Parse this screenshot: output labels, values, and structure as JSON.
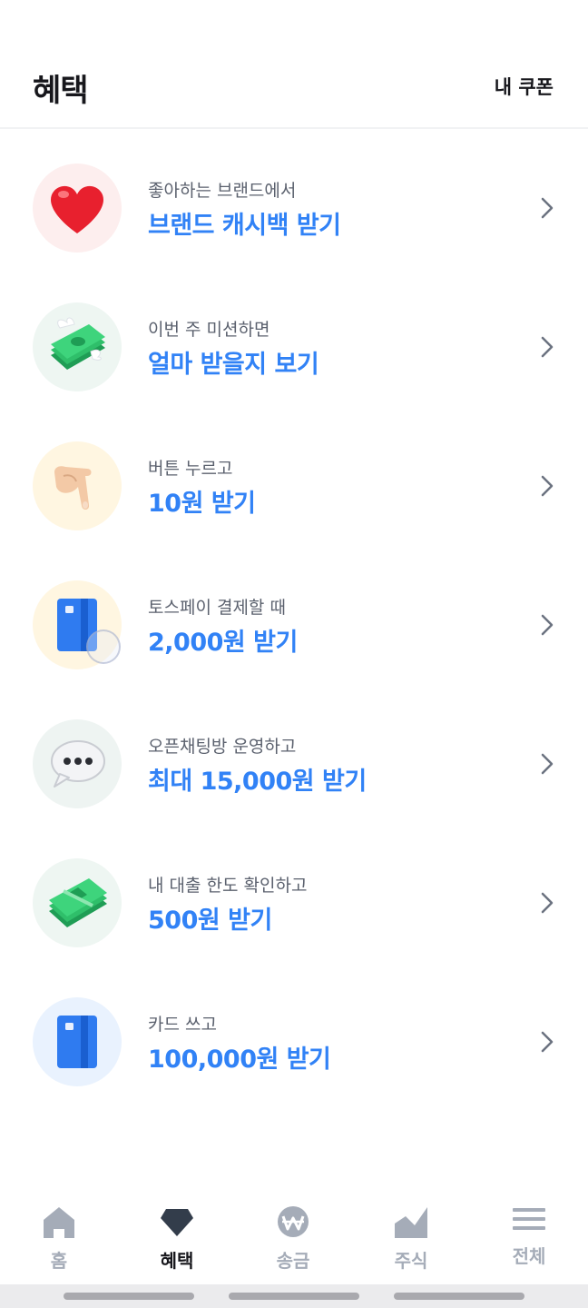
{
  "header": {
    "title": "혜택",
    "coupon_label": "내 쿠폰"
  },
  "benefits": [
    {
      "icon": "heart-icon",
      "subtitle": "좋아하는 브랜드에서",
      "title": "브랜드 캐시백 받기",
      "bg": "#fdeeee"
    },
    {
      "icon": "winged-money-icon",
      "subtitle": "이번 주 미션하면",
      "title": "얼마 받을지 보기",
      "bg": "#eef6f2"
    },
    {
      "icon": "pointing-hand-icon",
      "subtitle": "버튼 누르고",
      "title": "10원 받기",
      "bg": "#fff6e1"
    },
    {
      "icon": "card-icon",
      "subtitle": "토스페이 결제할 때",
      "title": "2,000원 받기",
      "bg": "#fff6e1"
    },
    {
      "icon": "speech-bubble-icon",
      "subtitle": "오픈채팅방 운영하고",
      "title": "최대 15,000원 받기",
      "bg": "#eef4f2"
    },
    {
      "icon": "money-stack-icon",
      "subtitle": "내 대출 한도 확인하고",
      "title": "500원 받기",
      "bg": "#eef6f2"
    },
    {
      "icon": "card-icon",
      "subtitle": "카드 쓰고",
      "title": "100,000원 받기",
      "bg": "#e9f2fe"
    }
  ],
  "tabs": [
    {
      "label": "홈",
      "icon": "home-icon",
      "active": false
    },
    {
      "label": "혜택",
      "icon": "gem-icon",
      "active": true
    },
    {
      "label": "송금",
      "icon": "won-coin-icon",
      "active": false
    },
    {
      "label": "주식",
      "icon": "chart-icon",
      "active": false
    },
    {
      "label": "전체",
      "icon": "menu-icon",
      "active": false
    }
  ],
  "colors": {
    "accent": "#3182f6",
    "text_dark": "#17171c",
    "text_sub": "#5b616e",
    "tab_inactive": "#a5acb8"
  }
}
